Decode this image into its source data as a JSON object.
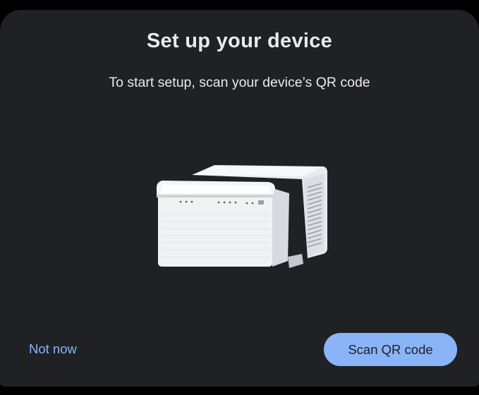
{
  "dialog": {
    "title": "Set up your device",
    "subtitle": "To start setup, scan your device’s QR code",
    "illustration": "window-air-conditioner-image"
  },
  "actions": {
    "secondary_label": "Not now",
    "primary_label": "Scan QR code"
  },
  "colors": {
    "sheet_background": "#202124",
    "text_primary": "#e8eaed",
    "accent": "#8ab4f8",
    "on_accent": "#202124"
  }
}
